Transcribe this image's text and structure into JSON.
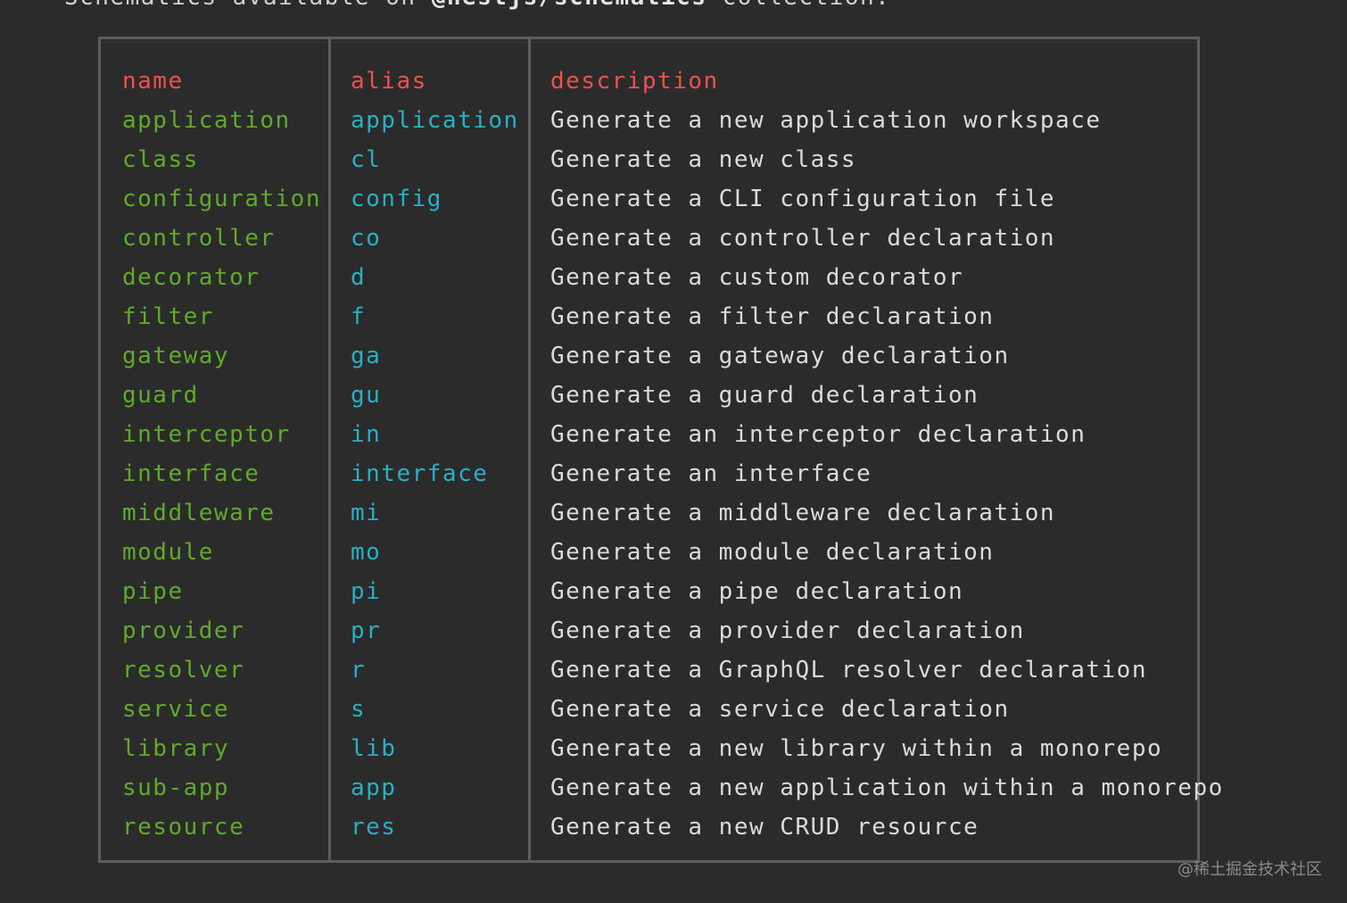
{
  "intro": {
    "prefix": "Schematics available on ",
    "collection": "@nestjs/schematics",
    "suffix": " collection:"
  },
  "table": {
    "headers": {
      "name": "name",
      "alias": "alias",
      "description": "description"
    },
    "rows": [
      {
        "name": "application",
        "alias": "application",
        "description": "Generate a new application workspace"
      },
      {
        "name": "class",
        "alias": "cl",
        "description": "Generate a new class"
      },
      {
        "name": "configuration",
        "alias": "config",
        "description": "Generate a CLI configuration file"
      },
      {
        "name": "controller",
        "alias": "co",
        "description": "Generate a controller declaration"
      },
      {
        "name": "decorator",
        "alias": "d",
        "description": "Generate a custom decorator"
      },
      {
        "name": "filter",
        "alias": "f",
        "description": "Generate a filter declaration"
      },
      {
        "name": "gateway",
        "alias": "ga",
        "description": "Generate a gateway declaration"
      },
      {
        "name": "guard",
        "alias": "gu",
        "description": "Generate a guard declaration"
      },
      {
        "name": "interceptor",
        "alias": "in",
        "description": "Generate an interceptor declaration"
      },
      {
        "name": "interface",
        "alias": "interface",
        "description": "Generate an interface"
      },
      {
        "name": "middleware",
        "alias": "mi",
        "description": "Generate a middleware declaration"
      },
      {
        "name": "module",
        "alias": "mo",
        "description": "Generate a module declaration"
      },
      {
        "name": "pipe",
        "alias": "pi",
        "description": "Generate a pipe declaration"
      },
      {
        "name": "provider",
        "alias": "pr",
        "description": "Generate a provider declaration"
      },
      {
        "name": "resolver",
        "alias": "r",
        "description": "Generate a GraphQL resolver declaration"
      },
      {
        "name": "service",
        "alias": "s",
        "description": "Generate a service declaration"
      },
      {
        "name": "library",
        "alias": "lib",
        "description": "Generate a new library within a monorepo"
      },
      {
        "name": "sub-app",
        "alias": "app",
        "description": "Generate a new application within a monorepo"
      },
      {
        "name": "resource",
        "alias": "res",
        "description": "Generate a new CRUD resource"
      }
    ]
  },
  "watermark": "@稀土掘金技术社区",
  "colors": {
    "background": "#2b2b2b",
    "header": "#f04f4f",
    "name": "#5faa2b",
    "alias": "#28b0c4",
    "description": "#d9dbde",
    "border": "#5d5d5d"
  }
}
